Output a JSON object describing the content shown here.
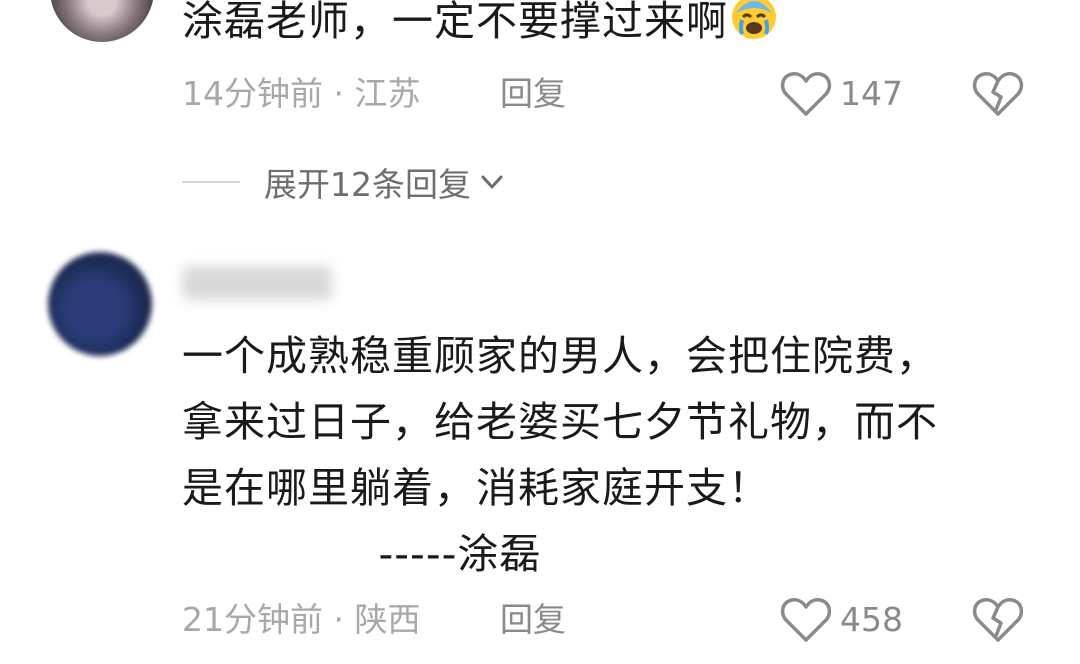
{
  "comment1": {
    "text": "涂磊老师，一定不要撑过来啊",
    "emoji": "crying-face-icon",
    "time_location": "14分钟前 · 江苏",
    "reply_label": "回复",
    "likes": "147"
  },
  "expand": {
    "label": "展开12条回复"
  },
  "comment2": {
    "lines": [
      "一个成熟稳重顾家的男人，会把住院费，",
      "拿来过日子，给老婆买七夕节礼物，而不",
      "是在哪里躺着，消耗家庭开支！",
      "              -----涂磊"
    ],
    "time_location": "21分钟前 · 陕西",
    "reply_label": "回复",
    "likes": "458"
  },
  "colors": {
    "text": "#1a1a1a",
    "meta": "#a8a8a8",
    "icon": "#8a8a8a"
  }
}
